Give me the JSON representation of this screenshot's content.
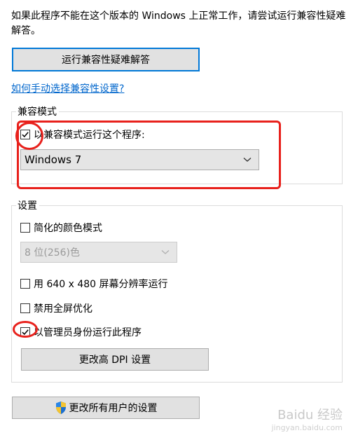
{
  "intro_text": "如果此程序不能在这个版本的 Windows 上正常工作，请尝试运行兼容性疑难解答。",
  "troubleshoot_button": "运行兼容性疑难解答",
  "manual_link": "如何手动选择兼容性设置?",
  "compat_mode": {
    "legend": "兼容模式",
    "checkbox_label": "以兼容模式运行这个程序:",
    "checked": true,
    "selected_os": "Windows 7"
  },
  "settings": {
    "legend": "设置",
    "reduced_color": {
      "label": "简化的颜色模式",
      "checked": false
    },
    "color_select": "8 位(256)色",
    "res_640": {
      "label": "用 640 x 480 屏幕分辨率运行",
      "checked": false
    },
    "disable_fullscreen": {
      "label": "禁用全屏优化",
      "checked": false
    },
    "run_as_admin": {
      "label": "以管理员身份运行此程序",
      "checked": true
    },
    "dpi_button": "更改高 DPI 设置"
  },
  "all_users_button": "更改所有用户的设置",
  "watermark": {
    "brand": "Baidu 经验",
    "url": "jingyan.baidu.com"
  },
  "colors": {
    "accent_border": "#0078d7",
    "link": "#0066cc",
    "annotation_red": "#e8211c",
    "button_bg": "#e1e1e1"
  }
}
